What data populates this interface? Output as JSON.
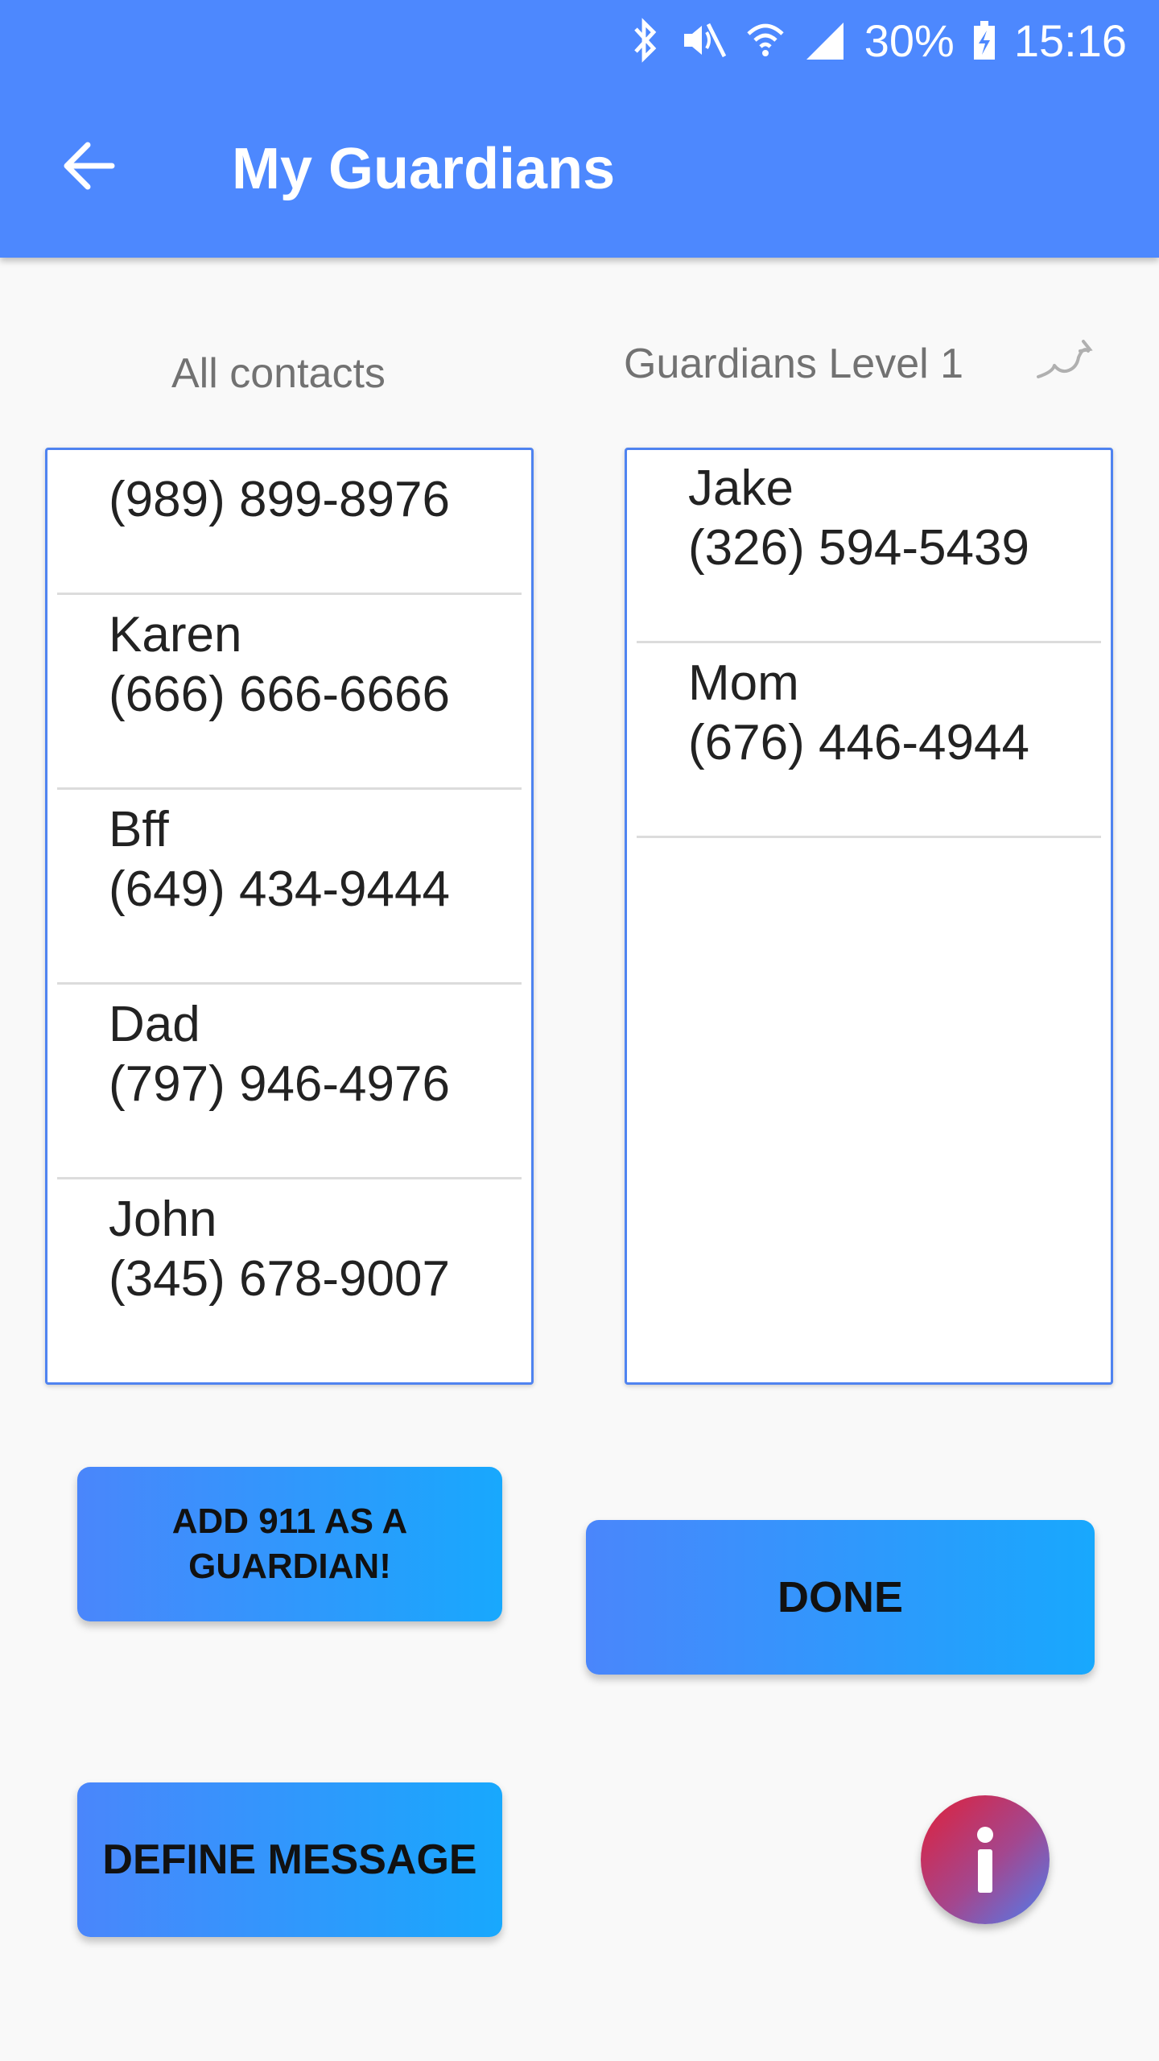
{
  "status_bar": {
    "battery": "30%",
    "time": "15:16",
    "icons": [
      "bluetooth-icon",
      "mute-icon",
      "wifi-icon",
      "signal-icon",
      "battery-charging-icon"
    ]
  },
  "app_bar": {
    "title": "My Guardians",
    "back_icon": "arrow-left-icon",
    "background": "#4d88fe"
  },
  "all_contacts": {
    "label": "All contacts",
    "items": [
      {
        "name": "",
        "phone": "(989) 899-8976"
      },
      {
        "name": "Karen",
        "phone": "(666) 666-6666"
      },
      {
        "name": "Bff",
        "phone": "(649) 434-9444"
      },
      {
        "name": "Dad",
        "phone": "(797) 946-4976"
      },
      {
        "name": "John",
        "phone": "(345) 678-9007"
      }
    ]
  },
  "guardians": {
    "label": "Guardians Level 1",
    "swap_icon": "swap-icon",
    "items": [
      {
        "name": "Jake",
        "phone": "(326) 594-5439"
      },
      {
        "name": "Mom",
        "phone": "(676) 446-4944"
      }
    ]
  },
  "buttons": {
    "add_911_line1": "ADD 911 AS A",
    "add_911_line2": "GUARDIAN!",
    "done": "DONE",
    "define_message": "DEFINE MESSAGE"
  },
  "info_fab": {
    "icon": "info-icon",
    "letter": "i"
  },
  "colors": {
    "accent": "#4d88fe",
    "button_gradient_start": "#4a86fb",
    "button_gradient_end": "#18a8fd",
    "list_border": "#4f83f0"
  }
}
